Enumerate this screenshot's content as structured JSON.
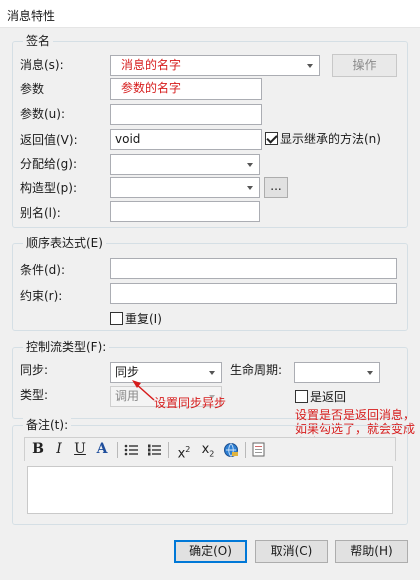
{
  "window": {
    "title": "消息特性"
  },
  "signature": {
    "legend": "签名",
    "message_label": "消息(s):",
    "message_value": "消息的名字",
    "action_button": "操作",
    "param_label": "参数",
    "param_value": "参数的名字",
    "param_u_label": "参数(u):",
    "param_u_value": "",
    "return_label": "返回值(V):",
    "return_value": "void",
    "show_inherited_label": "显示继承的方法(n)",
    "show_inherited_checked": true,
    "assign_label": "分配给(g):",
    "assign_value": "",
    "stereotype_label": "构造型(p):",
    "stereotype_value": "",
    "ellipsis_button": "...",
    "alias_label": "别名(l):",
    "alias_value": ""
  },
  "sequence": {
    "legend": "顺序表达式(E)",
    "condition_label": "条件(d):",
    "condition_value": "",
    "constraint_label": "约束(r):",
    "constraint_value": "",
    "repeat_label": "重复(I)",
    "repeat_checked": false
  },
  "control_flow": {
    "legend": "控制流类型(F):",
    "sync_label": "同步:",
    "sync_value": "同步",
    "lifecycle_label": "生命周期:",
    "lifecycle_value": "",
    "type_label": "类型:",
    "type_value": "调用",
    "is_return_label": "是返回",
    "is_return_checked": false
  },
  "annotations": {
    "sync_note": "设置同步异步",
    "return_note": "设置是否是返回消息，如果勾选了，就会变成虚线"
  },
  "notes": {
    "legend": "备注(t):",
    "toolbar": {
      "bold": "B",
      "italic": "I",
      "underline": "U",
      "font_color": "A",
      "bullet_list": "bullet-list-icon",
      "numbered_list": "numbered-list-icon",
      "superscript_base": "x",
      "superscript_mark": "2",
      "subscript_base": "x",
      "subscript_mark": "2",
      "hyperlink": "hyperlink-globe-icon",
      "document": "document-icon"
    },
    "content": ""
  },
  "footer": {
    "ok_button": "确定(O)",
    "cancel_button": "取消(C)",
    "help_button": "帮助(H)"
  },
  "colors": {
    "dialog_bg": "#f0f0f0",
    "annotation_red": "#d61c1c",
    "default_button_border": "#0078d7"
  }
}
